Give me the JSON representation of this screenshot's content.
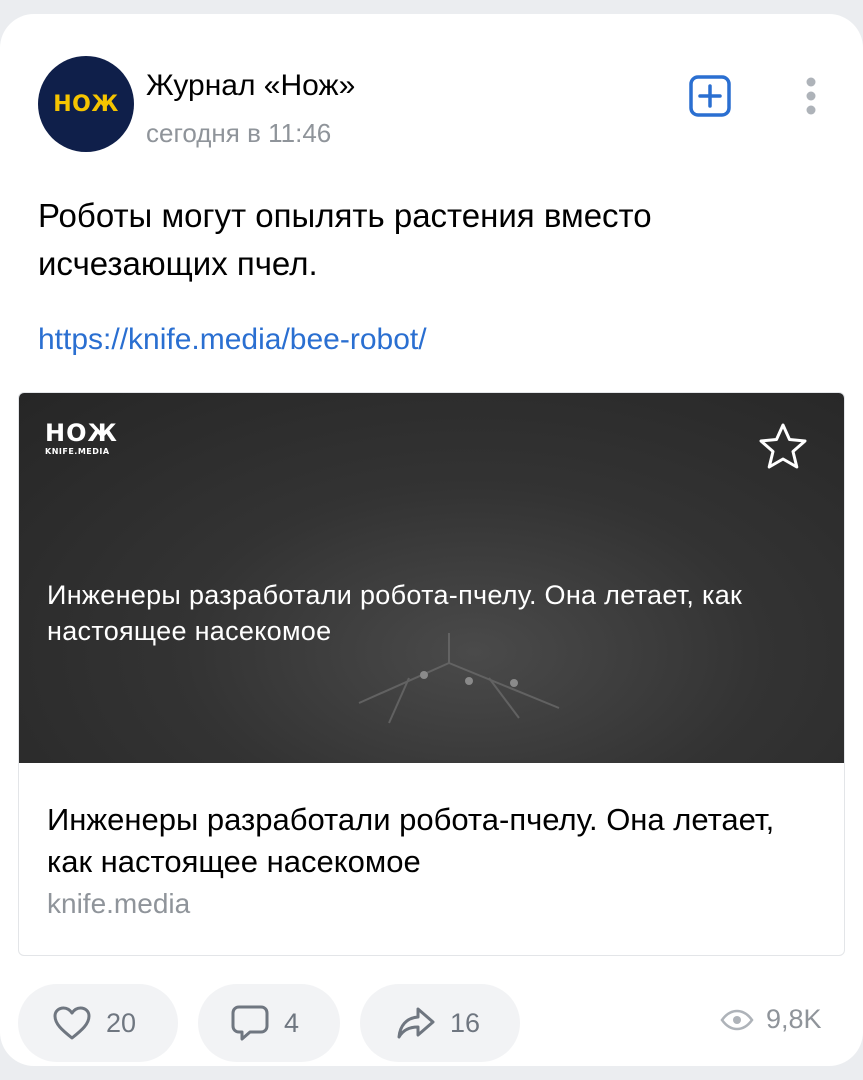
{
  "post": {
    "author": {
      "name": "Журнал «Нож»",
      "avatar_text": "НОЖ",
      "avatar_bg": "#0f1f4a",
      "avatar_fg": "#f5c400"
    },
    "time": "сегодня в 11:46",
    "text": "Роботы могут опылять растения вместо исчезающих пчел.",
    "link": "https://knife.media/bee-robot/",
    "snippet": {
      "image_logo": "НОЖ",
      "image_logo_sub": "KNIFE.MEDIA",
      "image_title": "Инженеры разработали робота-пчелу. Она летает, как настоящее насекомое",
      "title": "Инженеры разработали робота-пчелу. Она летает, как настоящее насекомое",
      "domain": "knife.media"
    },
    "actions": {
      "likes": "20",
      "comments": "4",
      "shares": "16",
      "views": "9,8K"
    }
  },
  "icons": {
    "subscribe": "plus-square-icon",
    "more": "more-vertical-icon",
    "favorite": "star-icon",
    "like": "heart-icon",
    "comment": "comment-icon",
    "share": "share-arrow-icon",
    "views": "eye-icon"
  },
  "colors": {
    "accent": "#2a6fd1",
    "secondary_text": "#8f949a",
    "action_bg": "#f2f3f5"
  }
}
